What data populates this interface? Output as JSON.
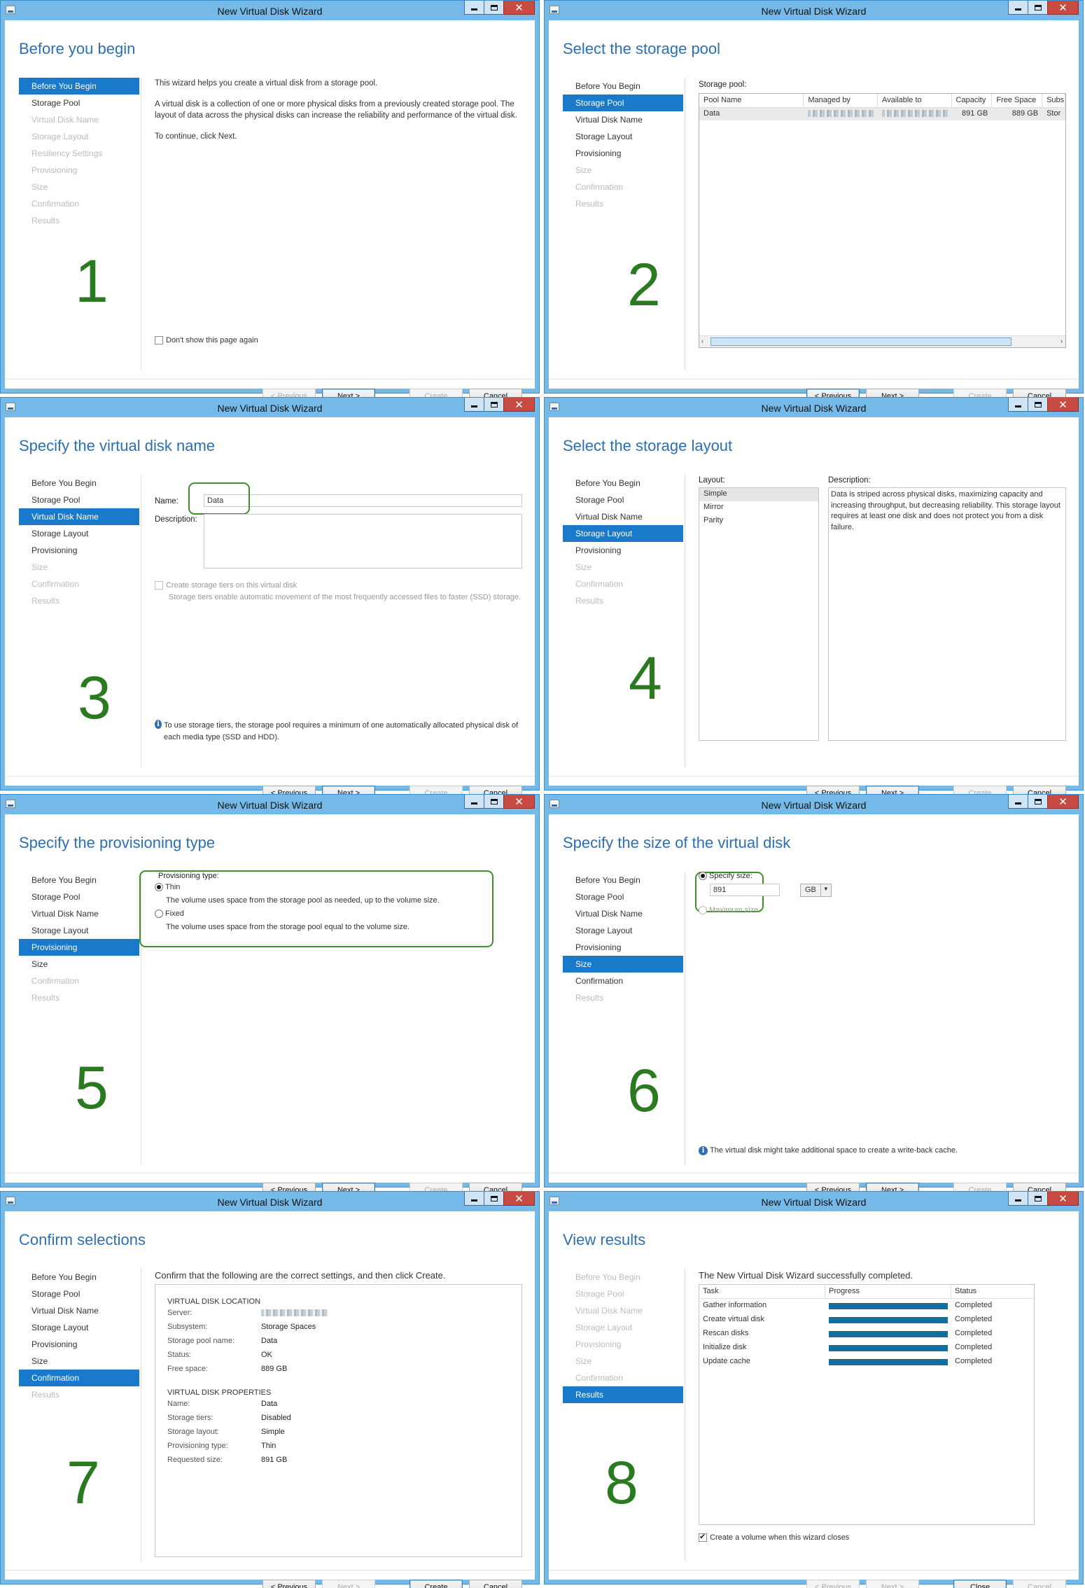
{
  "common": {
    "window_title": "New Virtual Disk Wizard",
    "buttons": {
      "previous": "< Previous",
      "next": "Next >",
      "create": "Create",
      "cancel": "Cancel",
      "close": "Close"
    },
    "nav_labels": [
      "Before You Begin",
      "Storage Pool",
      "Virtual Disk Name",
      "Storage Layout",
      "Resiliency Settings",
      "Provisioning",
      "Size",
      "Confirmation",
      "Results"
    ]
  },
  "panels": [
    {
      "step": "1",
      "heading": "Before you begin",
      "nav": [
        "Before You Begin",
        "Storage Pool",
        "Virtual Disk Name",
        "Storage Layout",
        "Resiliency Settings",
        "Provisioning",
        "Size",
        "Confirmation",
        "Results"
      ],
      "body": [
        "This wizard helps you create a virtual disk from a storage pool.",
        "A virtual disk is a collection of one or more physical disks from a previously created storage pool. The layout of data across the physical disks can increase the reliability and performance of the virtual disk.",
        "To continue, click Next."
      ],
      "dont_show": "Don't show this page again"
    },
    {
      "step": "2",
      "heading": "Select the storage pool",
      "nav": [
        "Before You Begin",
        "Storage Pool",
        "Virtual Disk Name",
        "Storage Layout",
        "Provisioning",
        "Size",
        "Confirmation",
        "Results"
      ],
      "grid_label": "Storage pool:",
      "columns": [
        "Pool Name",
        "Managed by",
        "Available to",
        "Capacity",
        "Free Space",
        "Subs"
      ],
      "row": {
        "name": "Data",
        "capacity": "891 GB",
        "free": "889 GB",
        "subs": "Stor"
      }
    },
    {
      "step": "3",
      "heading": "Specify the virtual disk name",
      "nav": [
        "Before You Begin",
        "Storage Pool",
        "Virtual Disk Name",
        "Storage Layout",
        "Provisioning",
        "Size",
        "Confirmation",
        "Results"
      ],
      "name_label": "Name:",
      "name_value": "Data",
      "desc_label": "Description:",
      "tiers_label": "Create storage tiers on this virtual disk",
      "tiers_desc": "Storage tiers enable automatic movement of the most frequently accessed files to faster (SSD) storage.",
      "info": "To use storage tiers, the storage pool requires a minimum of one automatically allocated physical disk of each media type (SSD and HDD)."
    },
    {
      "step": "4",
      "heading": "Select the storage layout",
      "nav": [
        "Before You Begin",
        "Storage Pool",
        "Virtual Disk Name",
        "Storage Layout",
        "Provisioning",
        "Size",
        "Confirmation",
        "Results"
      ],
      "layout_label": "Layout:",
      "layouts": [
        "Simple",
        "Mirror",
        "Parity"
      ],
      "desc_label": "Description:",
      "desc": "Data is striped across physical disks, maximizing capacity and increasing throughput, but decreasing reliability. This storage layout requires at least one disk and does not protect you from a disk failure."
    },
    {
      "step": "5",
      "heading": "Specify the provisioning type",
      "nav": [
        "Before You Begin",
        "Storage Pool",
        "Virtual Disk Name",
        "Storage Layout",
        "Provisioning",
        "Size",
        "Confirmation",
        "Results"
      ],
      "prov_label": "Provisioning type:",
      "thin": "Thin",
      "thin_desc": "The volume uses space from the storage pool as needed, up to the volume size.",
      "fixed": "Fixed",
      "fixed_desc": "The volume uses space from the storage pool equal to the volume size."
    },
    {
      "step": "6",
      "heading": "Specify the size of the virtual disk",
      "nav": [
        "Before You Begin",
        "Storage Pool",
        "Virtual Disk Name",
        "Storage Layout",
        "Provisioning",
        "Size",
        "Confirmation",
        "Results"
      ],
      "specify": "Specify size:",
      "size_value": "891",
      "unit": "GB",
      "max": "Maximum size",
      "info": "The virtual disk might take additional space to create a write-back cache."
    },
    {
      "step": "7",
      "heading": "Confirm selections",
      "nav": [
        "Before You Begin",
        "Storage Pool",
        "Virtual Disk Name",
        "Storage Layout",
        "Provisioning",
        "Size",
        "Confirmation",
        "Results"
      ],
      "intro": "Confirm that the following are the correct settings, and then click Create.",
      "loc_title": "VIRTUAL DISK LOCATION",
      "loc": [
        {
          "k": "Server:",
          "v": ""
        },
        {
          "k": "Subsystem:",
          "v": "Storage Spaces"
        },
        {
          "k": "Storage pool name:",
          "v": "Data"
        },
        {
          "k": "Status:",
          "v": "OK"
        },
        {
          "k": "Free space:",
          "v": "889 GB"
        }
      ],
      "prop_title": "VIRTUAL DISK PROPERTIES",
      "props": [
        {
          "k": "Name:",
          "v": "Data"
        },
        {
          "k": "Storage tiers:",
          "v": "Disabled"
        },
        {
          "k": "Storage layout:",
          "v": "Simple"
        },
        {
          "k": "Provisioning type:",
          "v": "Thin"
        },
        {
          "k": "Requested size:",
          "v": "891 GB"
        }
      ]
    },
    {
      "step": "8",
      "heading": "View results",
      "nav": [
        "Before You Begin",
        "Storage Pool",
        "Virtual Disk Name",
        "Storage Layout",
        "Provisioning",
        "Size",
        "Confirmation",
        "Results"
      ],
      "intro": "The New Virtual Disk Wizard successfully completed.",
      "cols": [
        "Task",
        "Progress",
        "Status"
      ],
      "tasks": [
        {
          "t": "Gather information",
          "s": "Completed",
          "p": 100
        },
        {
          "t": "Create virtual disk",
          "s": "Completed",
          "p": 100
        },
        {
          "t": "Rescan disks",
          "s": "Completed",
          "p": 100
        },
        {
          "t": "Initialize disk",
          "s": "Completed",
          "p": 100
        },
        {
          "t": "Update cache",
          "s": "Completed",
          "p": 100
        }
      ],
      "create_volume": "Create a volume when this wizard closes"
    }
  ]
}
